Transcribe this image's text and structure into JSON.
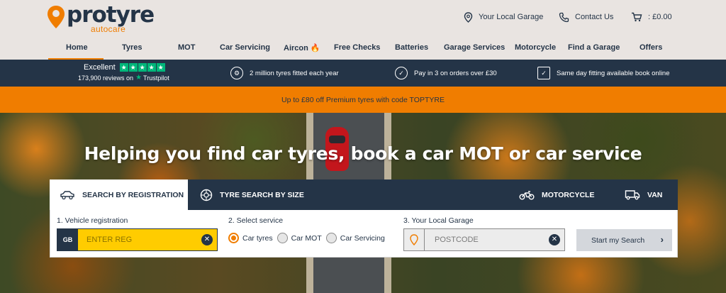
{
  "brand": {
    "name": "protyre",
    "sub": "autocare",
    "accent": "#f07d00",
    "navy": "#243447"
  },
  "utility": {
    "garage": "Your Local Garage",
    "contact": "Contact Us",
    "cart": ": £0.00"
  },
  "nav": [
    "Home",
    "Tyres",
    "MOT",
    "Car Servicing",
    "Aircon",
    "Free Checks",
    "Batteries",
    "Garage Services",
    "Motorcycle",
    "Find a Garage",
    "Offers"
  ],
  "nav_aircon_icon": "🔥",
  "trustpilot": {
    "label": "Excellent",
    "reviews": "173,900 reviews on",
    "brand": "Trustpilot",
    "rating": 5
  },
  "features": [
    "2 million tyres fitted each year",
    "Pay in 3 on orders over £30",
    "Same day fitting available book online"
  ],
  "promo": "Up to £80 off Premium tyres with code TOPTYRE",
  "hero": {
    "title": "Helping you find car tyres, book a car MOT or car service"
  },
  "tabs": {
    "registration": "SEARCH BY REGISTRATION",
    "size": "TYRE SEARCH BY SIZE",
    "motorcycle": "MOTORCYCLE",
    "van": "VAN"
  },
  "form": {
    "step1": "1. Vehicle registration",
    "gb": "GB",
    "reg_placeholder": "ENTER REG",
    "step2": "2. Select service",
    "services": [
      "Car tyres",
      "Car MOT",
      "Car Servicing"
    ],
    "selected_service": "Car tyres",
    "step3": "3. Your Local Garage",
    "postcode_placeholder": "POSTCODE",
    "submit": "Start my Search",
    "submit_icon": "›"
  }
}
